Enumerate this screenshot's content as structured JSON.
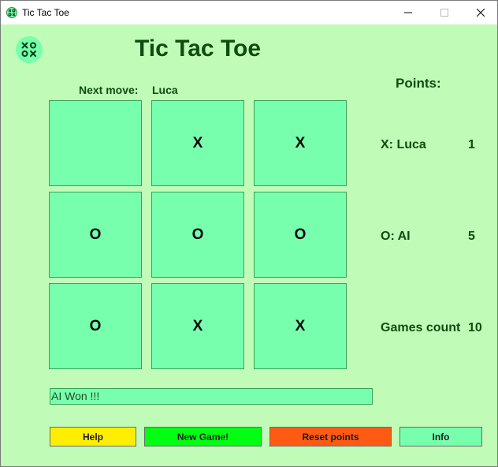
{
  "window": {
    "title": "Tic Tac Toe"
  },
  "header": {
    "title": "Tic Tac Toe",
    "next_move_label": "Next move:",
    "next_move_value": "Luca",
    "points_title": "Points:"
  },
  "board": {
    "cells": [
      "",
      "X",
      "X",
      "O",
      "O",
      "O",
      "O",
      "X",
      "X"
    ]
  },
  "scores": {
    "x_label": "X:  Luca",
    "x_value": "1",
    "o_label": "O:  AI",
    "o_value": "5",
    "games_label": "Games count",
    "games_value": "10"
  },
  "status": {
    "message": "AI Won !!!"
  },
  "buttons": {
    "help": "Help",
    "new_game": "New Game!",
    "reset": "Reset points",
    "info": "Info"
  },
  "colors": {
    "background": "#c1fbb8",
    "cell": "#77ffae",
    "help": "#ffee00",
    "new_game": "#00ff12",
    "reset": "#ff5a14",
    "info": "#77ffae",
    "text_dark_green": "#0e4d0e"
  },
  "icons": {
    "app": "tic-tac-toe-icon",
    "minimize": "minimize-icon",
    "maximize": "maximize-icon",
    "close": "close-icon"
  }
}
